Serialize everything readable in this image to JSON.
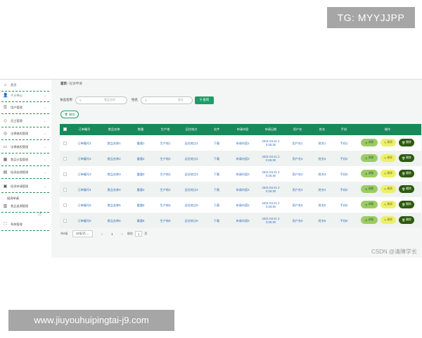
{
  "watermarks": {
    "tg": "TG: MYYJJPP",
    "url": "www.jiuyouhuipingtai-j9.com",
    "csdn": "CSDN @清陳学长"
  },
  "sidebar": {
    "items": [
      {
        "label": "首页",
        "icon": "home-icon"
      },
      {
        "label": "个人中心",
        "icon": "user-icon"
      },
      {
        "label": "用户管理",
        "icon": "list-icon"
      },
      {
        "label": "员工管理",
        "icon": "staff-icon"
      },
      {
        "label": "法律维权管理",
        "icon": "scale-icon"
      },
      {
        "label": "法律维权管理",
        "icon": "doc-icon"
      },
      {
        "label": "食品分类管理",
        "icon": "category-icon"
      },
      {
        "label": "投诉处理管理",
        "icon": "complaint-icon"
      },
      {
        "label": "投诉申请管理",
        "icon": "apply-icon"
      },
      {
        "label": "食品追溯管理",
        "icon": "trace-icon"
      },
      {
        "label": "系统管理",
        "icon": "system-icon"
      }
    ],
    "sub_item": "投诉申请"
  },
  "breadcrumb": {
    "home": "首页",
    "sep": "/",
    "current": "投诉申请"
  },
  "search": {
    "label1": "食品名称",
    "placeholder1": "食品名称",
    "label2": "姓名",
    "placeholder2": "姓名",
    "query_label": "查询",
    "delete_label": "删除"
  },
  "table": {
    "headers": [
      "订单编号",
      "食品名称",
      "数量",
      "生产地",
      "运往地点",
      "文件",
      "申请内容",
      "申请日期",
      "用户名",
      "姓名",
      "手机",
      "操作"
    ],
    "rows": [
      [
        "订单编号1",
        "食品名称1",
        "重量1",
        "生产地1",
        "运往地点1",
        "下载",
        "申请内容1",
        "2021-04-21 2 0:25:30",
        "用户名1",
        "姓名1",
        "手机1"
      ],
      [
        "订单编号2",
        "食品名称2",
        "重量2",
        "生产地2",
        "运往地点2",
        "下载",
        "申请内容2",
        "2021-04-21 2 0:25:30",
        "用户名2",
        "姓名2",
        "手机2"
      ],
      [
        "订单编号3",
        "食品名称3",
        "重量3",
        "生产地3",
        "运往地点3",
        "下载",
        "申请内容3",
        "2021-04-21 2 0:25:30",
        "用户名3",
        "姓名3",
        "手机3"
      ],
      [
        "订单编号4",
        "食品名称4",
        "重量4",
        "生产地4",
        "运往地点4",
        "下载",
        "申请内容4",
        "2021-04-21 2 0:25:30",
        "用户名4",
        "姓名4",
        "手机4"
      ],
      [
        "订单编号5",
        "食品名称5",
        "重量5",
        "生产地5",
        "运往地点5",
        "下载",
        "申请内容5",
        "2021-04-21 2 0:25:30",
        "用户名5",
        "姓名5",
        "手机5"
      ],
      [
        "订单编号6",
        "食品名称6",
        "重量6",
        "生产地6",
        "运往地点6",
        "下载",
        "申请内容6",
        "2021-04-21 2 0:25:30",
        "用户名6",
        "姓名6",
        "手机6"
      ]
    ],
    "actions": {
      "detail": "详情",
      "edit": "修改",
      "delete": "删除"
    }
  },
  "pager": {
    "total": "共6条",
    "size": "10条/页",
    "prev": "<",
    "current": "1",
    "next": ">",
    "goto": "前往",
    "goto_value": "1",
    "page_unit": "页"
  },
  "colors": {
    "primary": "#178a5a",
    "button": "#1f9c68",
    "detail": "#9ccc65",
    "edit": "#eef06a",
    "delete": "#2d5a10"
  }
}
